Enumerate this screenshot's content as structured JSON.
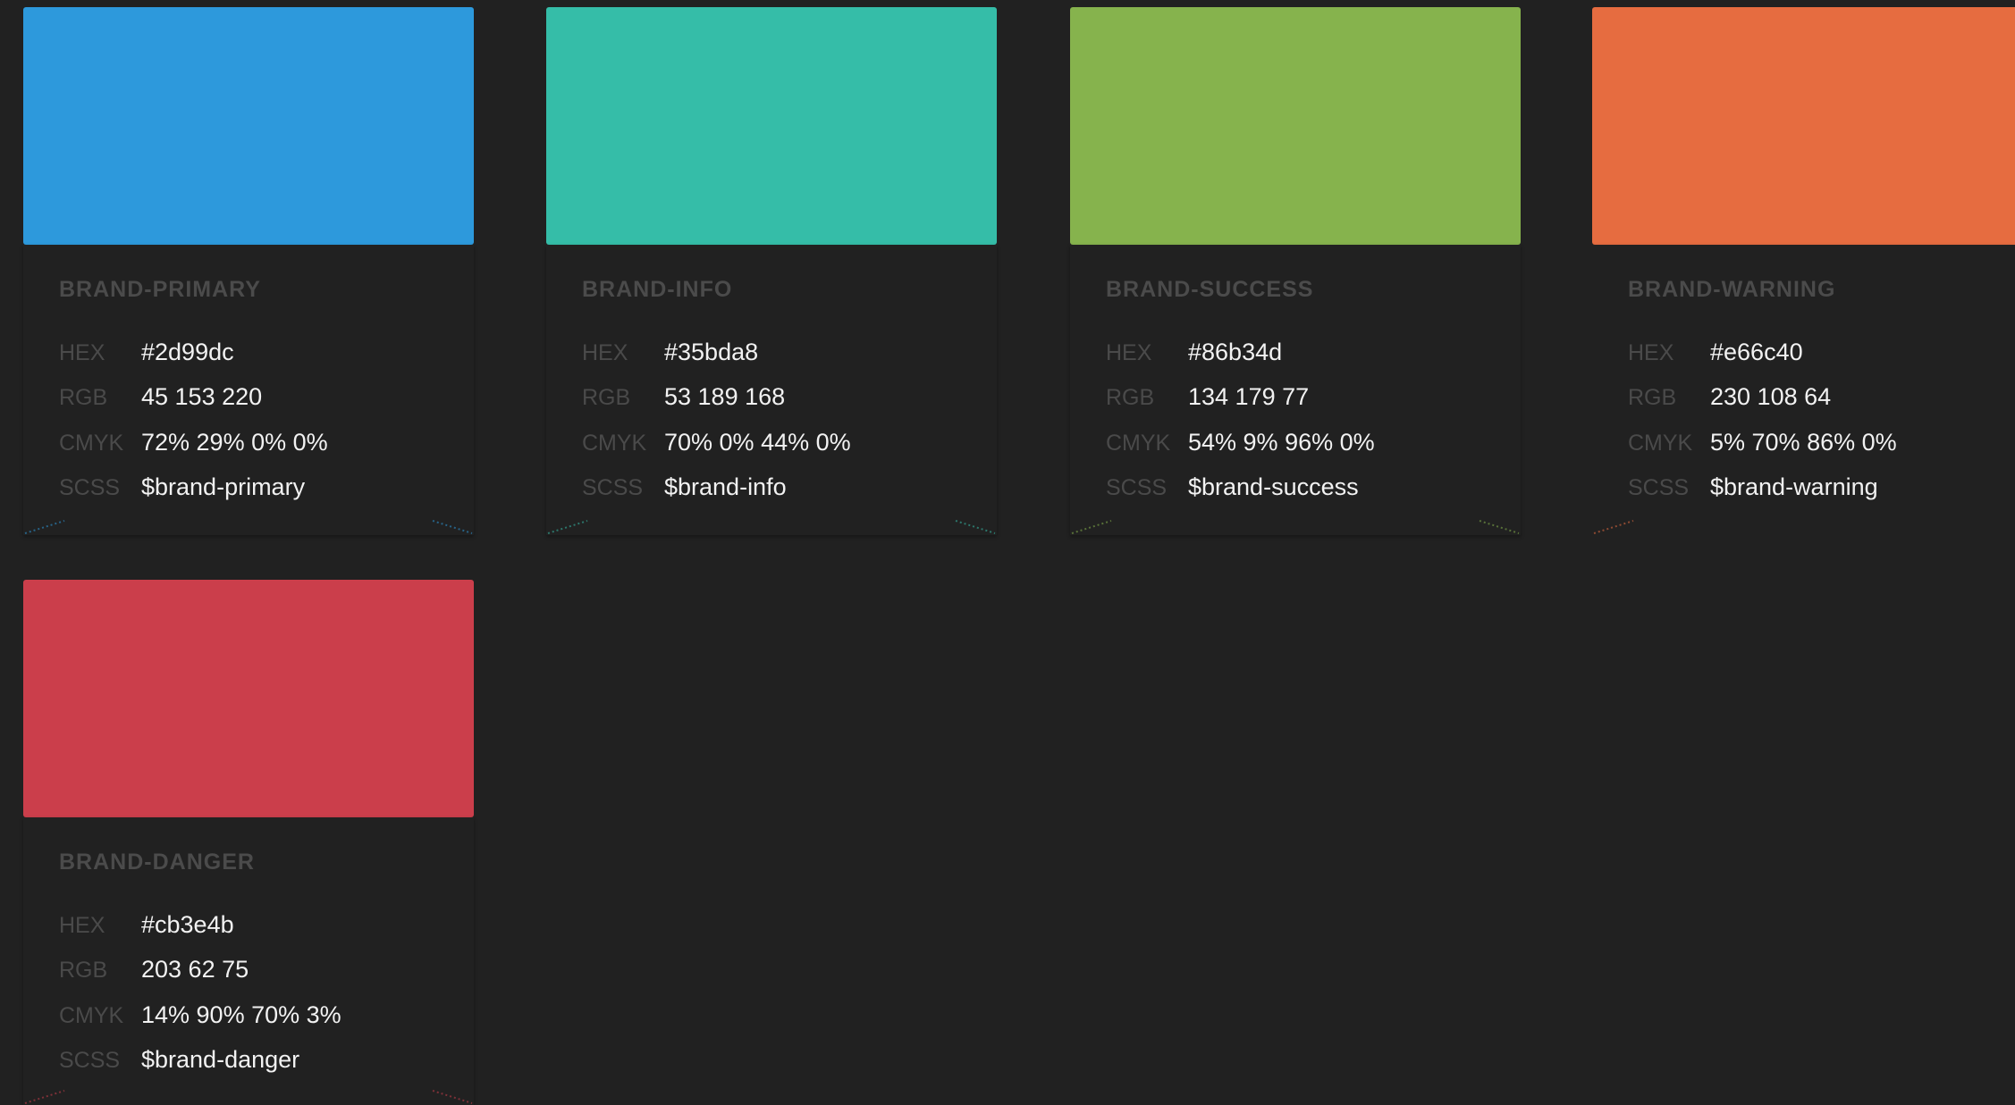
{
  "cards": [
    {
      "id": "brand-primary",
      "name": "BRAND-PRIMARY",
      "color": "#2d99dc",
      "hex_label": "HEX",
      "hex": "#2d99dc",
      "rgb_label": "RGB",
      "rgb": "45 153 220",
      "cmyk_label": "CMYK",
      "cmyk": "72% 29% 0% 0%",
      "scss_label": "SCSS",
      "scss": "$brand-primary"
    },
    {
      "id": "brand-info",
      "name": "BRAND-INFO",
      "color": "#35bda8",
      "hex_label": "HEX",
      "hex": "#35bda8",
      "rgb_label": "RGB",
      "rgb": "53 189 168",
      "cmyk_label": "CMYK",
      "cmyk": "70% 0% 44% 0%",
      "scss_label": "SCSS",
      "scss": "$brand-info"
    },
    {
      "id": "brand-success",
      "name": "BRAND-SUCCESS",
      "color": "#86b34d",
      "hex_label": "HEX",
      "hex": "#86b34d",
      "rgb_label": "RGB",
      "rgb": "134 179 77",
      "cmyk_label": "CMYK",
      "cmyk": "54% 9% 96% 0%",
      "scss_label": "SCSS",
      "scss": "$brand-success"
    },
    {
      "id": "brand-warning",
      "name": "BRAND-WARNING",
      "color": "#e66c40",
      "hex_label": "HEX",
      "hex": "#e66c40",
      "rgb_label": "RGB",
      "rgb": "230 108 64",
      "cmyk_label": "CMYK",
      "cmyk": "5% 70% 86% 0%",
      "scss_label": "SCSS",
      "scss": "$brand-warning"
    },
    {
      "id": "brand-danger",
      "name": "BRAND-DANGER",
      "color": "#cb3e4b",
      "hex_label": "HEX",
      "hex": "#cb3e4b",
      "rgb_label": "RGB",
      "rgb": "203 62 75",
      "cmyk_label": "CMYK",
      "cmyk": "14% 90% 70% 3%",
      "scss_label": "SCSS",
      "scss": "$brand-danger"
    }
  ]
}
